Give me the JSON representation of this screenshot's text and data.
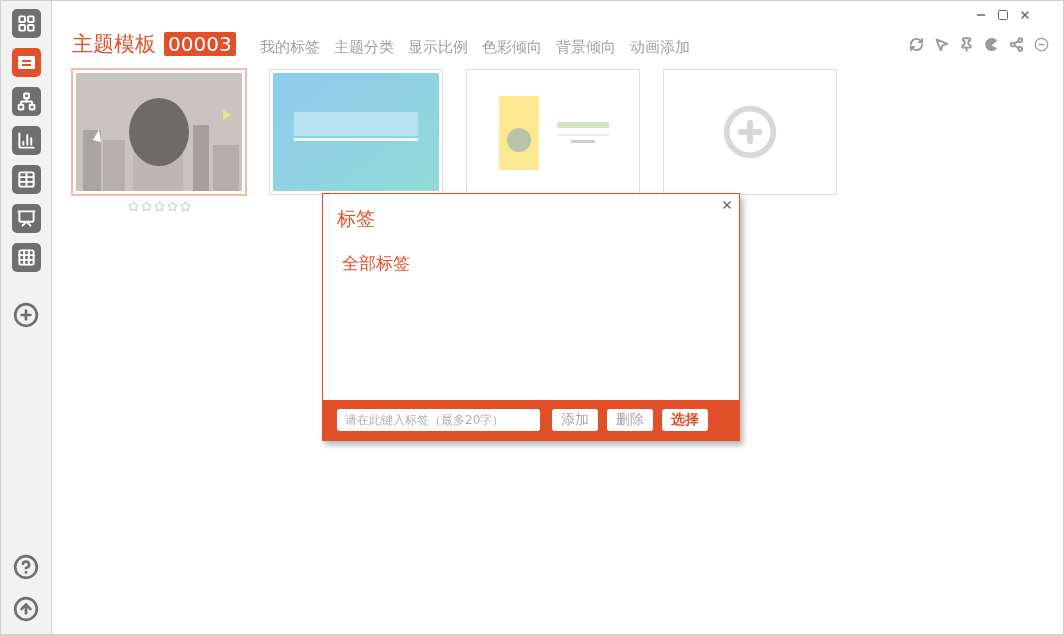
{
  "sidebar": {
    "items": [
      {
        "kind": "grid",
        "selected": false
      },
      {
        "kind": "list",
        "selected": true
      },
      {
        "kind": "org",
        "selected": false
      },
      {
        "kind": "chart",
        "selected": false
      },
      {
        "kind": "table",
        "selected": false
      },
      {
        "kind": "presentation",
        "selected": false
      },
      {
        "kind": "grid9",
        "selected": false
      }
    ]
  },
  "header": {
    "title": "主题模板",
    "count": "00003",
    "tabs": [
      "我的标签",
      "主题分类",
      "显示比例",
      "色彩倾向",
      "背景倾向",
      "动画添加"
    ]
  },
  "templates": [
    {
      "kind": "picture",
      "selected": true,
      "stars": 0
    },
    {
      "kind": "picture",
      "selected": false
    },
    {
      "kind": "picture",
      "selected": false
    },
    {
      "kind": "add",
      "selected": false
    }
  ],
  "dialog": {
    "title": "标签",
    "tags": [
      "全部标签"
    ],
    "input": {
      "placeholder": "请在此键入标签（最多20字）"
    },
    "buttons": [
      {
        "label": "添加",
        "primary": false
      },
      {
        "label": "删除",
        "primary": false
      },
      {
        "label": "选择",
        "primary": true
      }
    ]
  }
}
